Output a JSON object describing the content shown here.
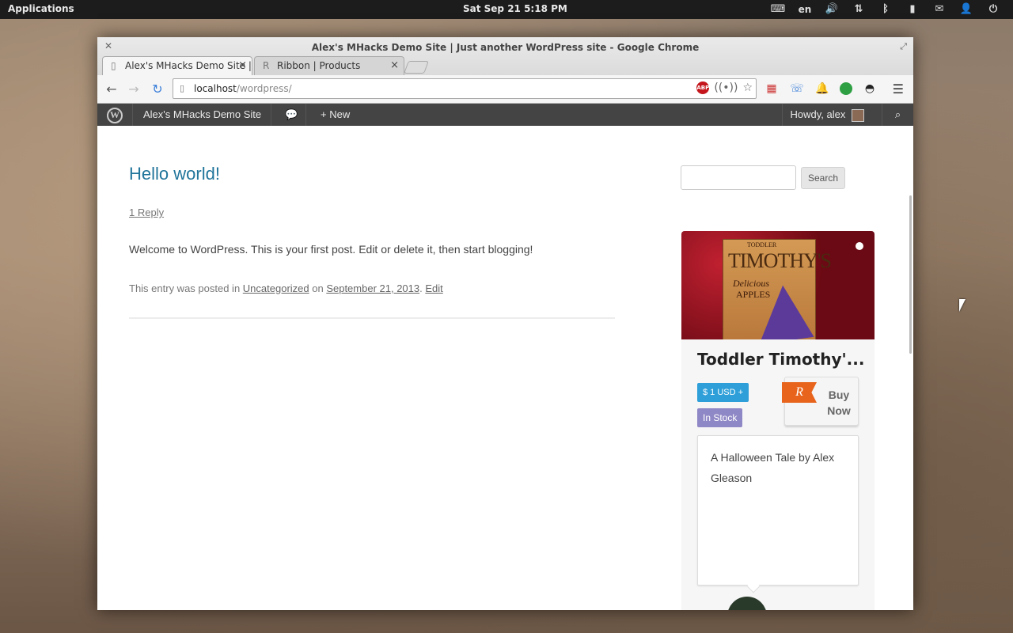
{
  "desktop": {
    "applications_label": "Applications",
    "clock": "Sat Sep 21  5:18 PM",
    "language": "en"
  },
  "browser": {
    "window_title": "Alex's MHacks Demo Site | Just another WordPress site - Google Chrome",
    "tabs": [
      {
        "label": "Alex's MHacks Demo Site | ",
        "active": true
      },
      {
        "label": "Ribbon | Products",
        "active": false
      }
    ],
    "url_host": "localhost",
    "url_path": "/wordpress/",
    "abp_label": "ABP",
    "ext_badge": "25"
  },
  "adminbar": {
    "site_name": "Alex's MHacks Demo Site",
    "new_label": "New",
    "howdy": "Howdy, alex"
  },
  "post": {
    "title": "Hello world!",
    "reply_link": "1 Reply",
    "body": "Welcome to WordPress. This is your first post. Edit or delete it, then start blogging!",
    "meta_prefix": "This entry was posted in ",
    "category": "Uncategorized",
    "meta_on": " on ",
    "date": "September 21, 2013",
    "meta_sep": ". ",
    "edit": "Edit"
  },
  "sidebar": {
    "search_button": "Search"
  },
  "product": {
    "book_title": "TIMOTHY'S",
    "book_top": "TODDLER",
    "book_sub": "Delicious",
    "book_sub2": "APPLES",
    "name": "Toddler Timothy'...",
    "price": "$ 1 USD +",
    "stock": "In Stock",
    "buy_label": "Buy Now",
    "description": "A Halloween Tale by Alex Gleason"
  },
  "colors": {
    "link": "#21759b",
    "price_badge": "#2e9fd8",
    "stock_badge": "#8f88c6",
    "ribbon_orange": "#e8641c"
  }
}
